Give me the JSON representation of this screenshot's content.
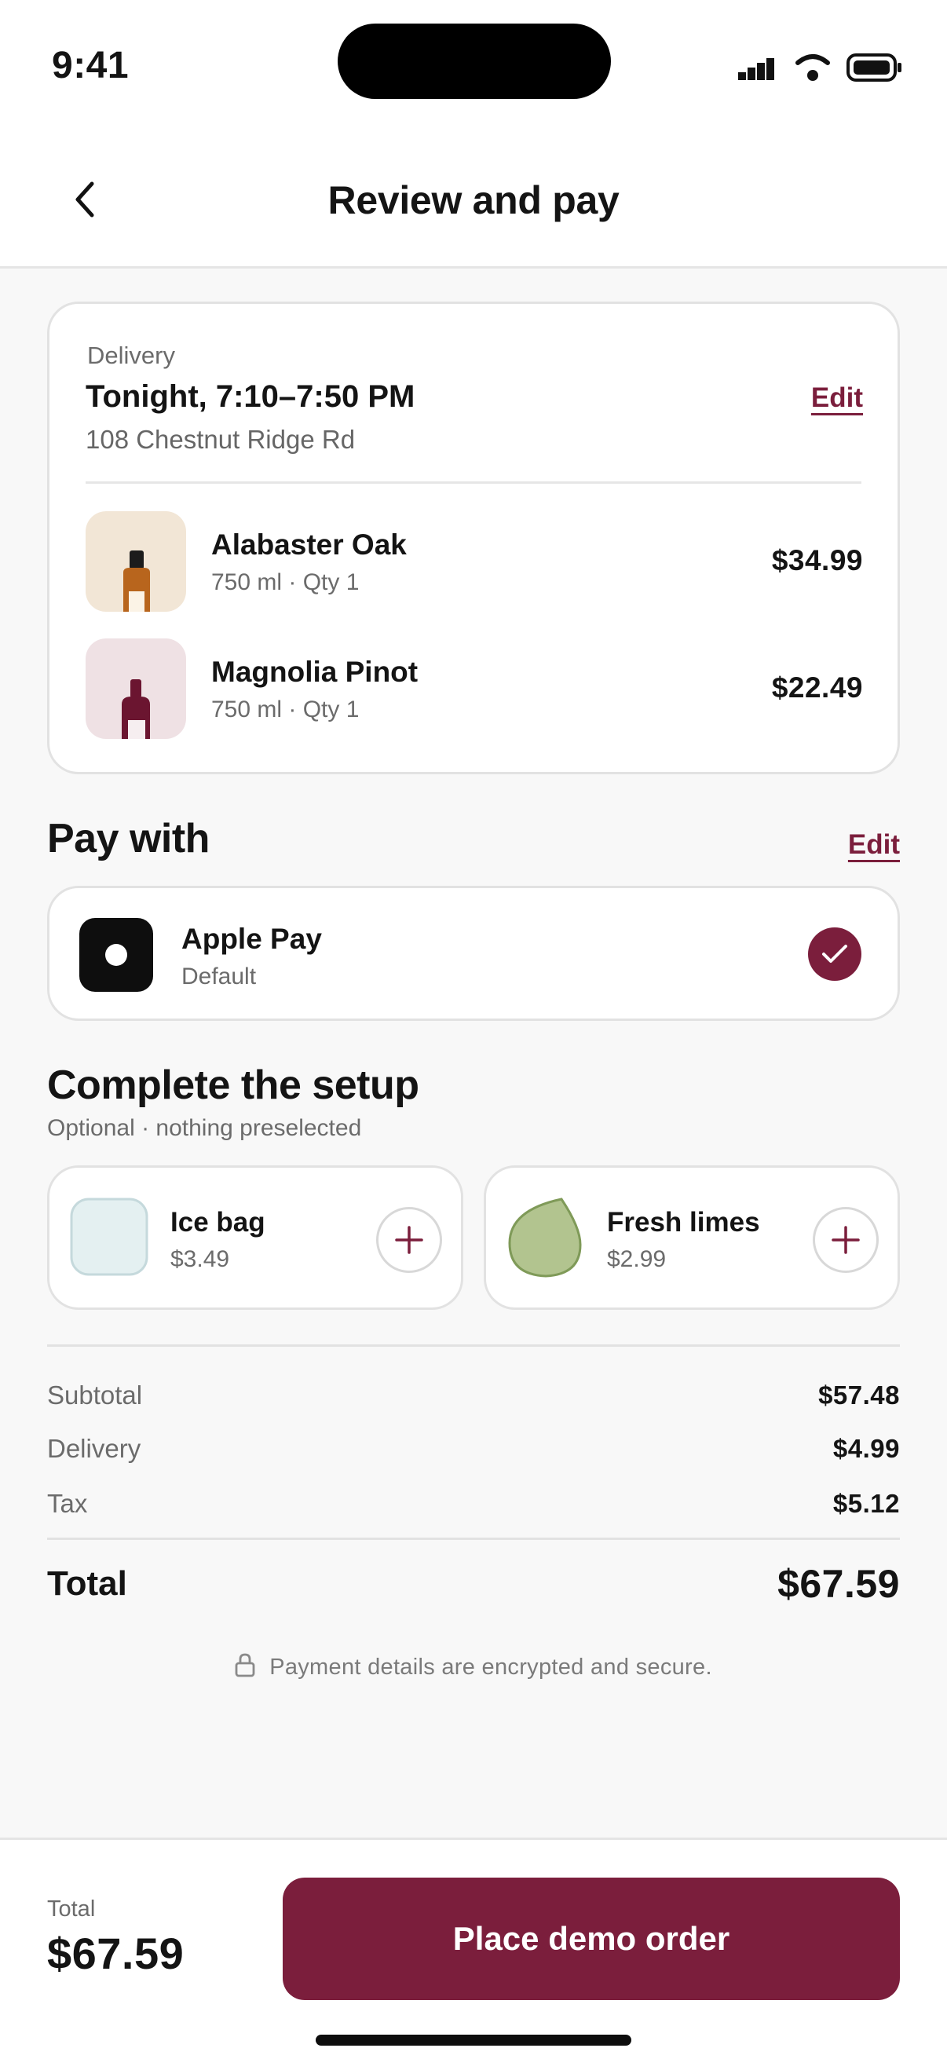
{
  "status_bar": {
    "time": "9:41"
  },
  "header": {
    "title": "Review and pay"
  },
  "delivery": {
    "label": "Delivery",
    "time": "Tonight, 7:10–7:50 PM",
    "address": "108 Chestnut Ridge Rd",
    "edit_label": "Edit"
  },
  "items": [
    {
      "name": "Alabaster Oak",
      "meta": "750 ml · Qty 1",
      "price": "$34.99"
    },
    {
      "name": "Magnolia Pinot",
      "meta": "750 ml · Qty 1",
      "price": "$22.49"
    }
  ],
  "payment": {
    "title": "Pay with",
    "edit_label": "Edit",
    "method_name": "Apple Pay",
    "method_sub": "Default",
    "selected": true
  },
  "setup": {
    "title": "Complete the setup",
    "subtitle": "Optional · nothing preselected",
    "addons": [
      {
        "name": "Ice bag",
        "price": "$3.49",
        "icon": "ice-bag-icon"
      },
      {
        "name": "Fresh limes",
        "price": "$2.99",
        "icon": "lime-icon"
      }
    ]
  },
  "summary": {
    "subtotal_label": "Subtotal",
    "subtotal": "$57.48",
    "delivery_label": "Delivery",
    "delivery": "$4.99",
    "tax_label": "Tax",
    "tax": "$5.12",
    "total_label": "Total",
    "total": "$67.59",
    "secure_note": "Payment details are encrypted and secure."
  },
  "bottom_bar": {
    "total_label": "Total",
    "total": "$67.59",
    "cta_label": "Place demo order"
  },
  "colors": {
    "accent": "#7b1e3c",
    "background": "#f8f8f8",
    "card": "#ffffff"
  }
}
